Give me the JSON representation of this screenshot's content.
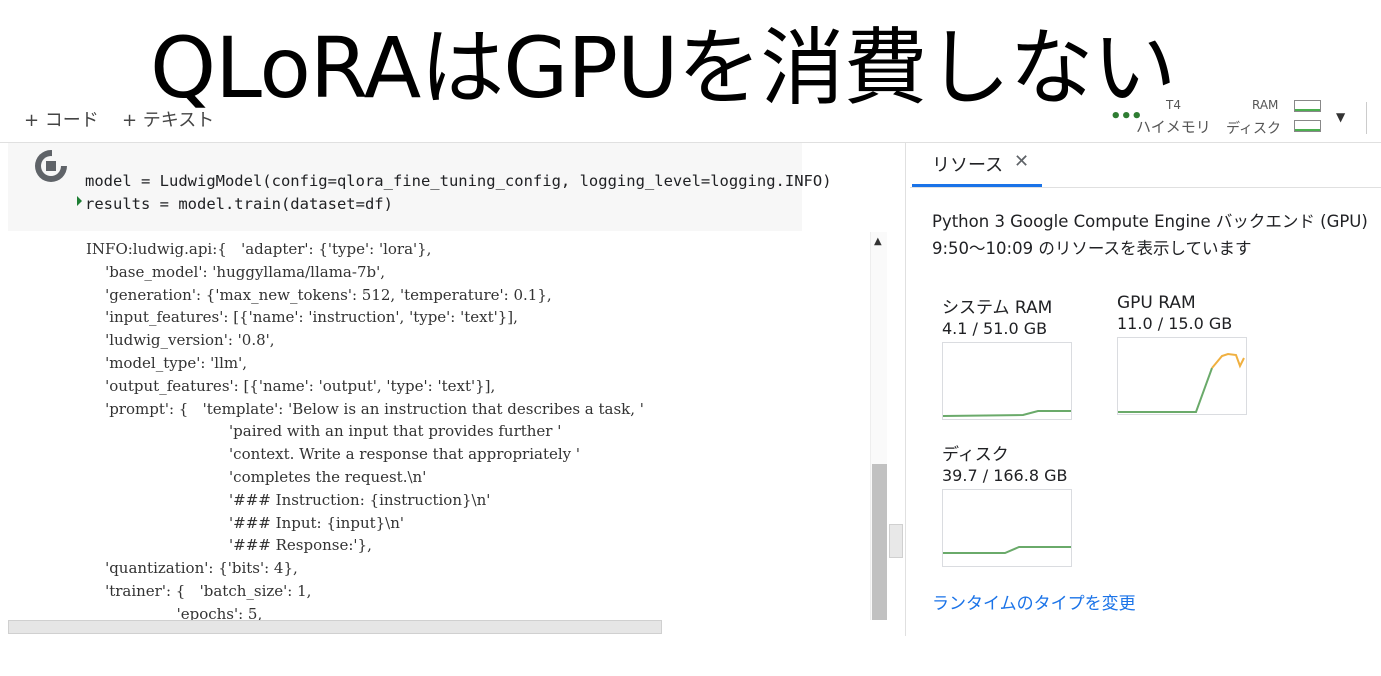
{
  "slide_title": "QLoRAはGPUを消費しない",
  "toolbar": {
    "add_code": "+ コード",
    "add_text": "+ テキスト",
    "gpu_label": "T4",
    "highmem_label": "ハイメモリ",
    "ram_label": "RAM",
    "disk_label": "ディスク"
  },
  "cell": {
    "line1": "model = LudwigModel(config=qlora_fine_tuning_config, logging_level=logging.INFO)",
    "line2": "results = model.train(dataset=df)"
  },
  "output": {
    "lines": [
      "INFO:ludwig.api:{   'adapter': {'type': 'lora'},",
      "    'base_model': 'huggyllama/llama-7b',",
      "    'generation': {'max_new_tokens': 512, 'temperature': 0.1},",
      "    'input_features': [{'name': 'instruction', 'type': 'text'}],",
      "    'ludwig_version': '0.8',",
      "    'model_type': 'llm',",
      "    'output_features': [{'name': 'output', 'type': 'text'}],",
      "    'prompt': {   'template': 'Below is an instruction that describes a task, '",
      "                              'paired with an input that provides further '",
      "                              'context. Write a response that appropriately '",
      "                              'completes the request.\\n'",
      "                              '### Instruction: {instruction}\\n'",
      "                              '### Input: {input}\\n'",
      "                              '### Response:'},",
      "    'quantization': {'bits': 4},",
      "    'trainer': {   'batch_size': 1,",
      "                   'epochs': 5,"
    ]
  },
  "resources": {
    "tab_label": "リソース",
    "backend": "Python 3 Google Compute Engine バックエンド (GPU)",
    "time_range": "9:50～10:09 のリソースを表示しています",
    "metrics": [
      {
        "name": "システム RAM",
        "value": "4.1 / 51.0 GB"
      },
      {
        "name": "GPU RAM",
        "value": "11.0 / 15.0 GB"
      },
      {
        "name": "ディスク",
        "value": "39.7 / 166.8 GB"
      }
    ],
    "change_runtime": "ランタイムのタイプを変更"
  },
  "colors": {
    "accent": "#1a73e8",
    "usage_green": "#6aaa6a",
    "usage_orange": "#f0b040"
  }
}
